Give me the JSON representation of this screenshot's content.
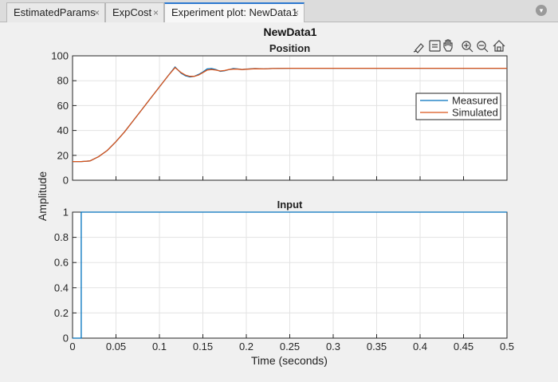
{
  "tabs": [
    {
      "label": "EstimatedParams",
      "close": "×"
    },
    {
      "label": "ExpCost",
      "close": "×"
    },
    {
      "label": "Experiment plot: NewData1",
      "close": "×"
    }
  ],
  "menu_icon": "chevron-down-icon",
  "figure": {
    "title": "NewData1",
    "ylabel": "Amplitude",
    "xlabel": "Time (seconds)",
    "toolbar_icons": [
      "brush-icon",
      "data-tips-icon",
      "pan-hand-icon",
      "zoom-in-icon",
      "zoom-out-icon",
      "home-icon"
    ]
  },
  "chart_data": [
    {
      "type": "line",
      "title": "Position",
      "xlim": [
        0,
        0.5
      ],
      "ylim": [
        0,
        100
      ],
      "xticks": [
        0,
        0.05,
        0.1,
        0.15,
        0.2,
        0.25,
        0.3,
        0.35,
        0.4,
        0.45,
        0.5
      ],
      "yticks": [
        0,
        20,
        40,
        60,
        80,
        100
      ],
      "yticklabels": [
        "0",
        "20",
        "40",
        "60",
        "80",
        "100"
      ],
      "grid": true,
      "legend": "right",
      "series": [
        {
          "name": "Measured",
          "color": "#0072bd",
          "x": [
            0,
            0.01,
            0.02,
            0.03,
            0.04,
            0.05,
            0.06,
            0.07,
            0.08,
            0.09,
            0.1,
            0.11,
            0.118,
            0.125,
            0.13,
            0.135,
            0.14,
            0.145,
            0.15,
            0.155,
            0.16,
            0.165,
            0.17,
            0.175,
            0.18,
            0.185,
            0.19,
            0.195,
            0.2,
            0.21,
            0.22,
            0.23,
            0.25,
            0.3,
            0.35,
            0.4,
            0.45,
            0.5
          ],
          "y": [
            15,
            15,
            15.5,
            19,
            24,
            31,
            39,
            48,
            57,
            66,
            75,
            84,
            91,
            86,
            84,
            83,
            83.5,
            85,
            87,
            89.5,
            89.8,
            89,
            87.5,
            88,
            89,
            89.8,
            89.5,
            89,
            89.3,
            89.8,
            89.5,
            89.8,
            90,
            90,
            90,
            90,
            90,
            90
          ]
        },
        {
          "name": "Simulated",
          "color": "#d95319",
          "x": [
            0,
            0.01,
            0.02,
            0.03,
            0.04,
            0.05,
            0.06,
            0.07,
            0.08,
            0.09,
            0.1,
            0.11,
            0.118,
            0.125,
            0.13,
            0.135,
            0.14,
            0.145,
            0.15,
            0.155,
            0.16,
            0.165,
            0.17,
            0.175,
            0.18,
            0.185,
            0.19,
            0.195,
            0.2,
            0.21,
            0.22,
            0.23,
            0.25,
            0.3,
            0.35,
            0.4,
            0.45,
            0.5
          ],
          "y": [
            15,
            15,
            15.5,
            19,
            24,
            31,
            39,
            48,
            57,
            66,
            75,
            84,
            90.5,
            86.5,
            84.5,
            83.5,
            83.5,
            84.5,
            86.5,
            88.5,
            89,
            88.5,
            87.8,
            88.2,
            89,
            89.3,
            89.3,
            89,
            89.2,
            89.6,
            89.5,
            89.8,
            90,
            90,
            90,
            90,
            90,
            90
          ]
        }
      ]
    },
    {
      "type": "line",
      "title": "Input",
      "xlim": [
        0,
        0.5
      ],
      "ylim": [
        0,
        1
      ],
      "xticks": [
        0,
        0.05,
        0.1,
        0.15,
        0.2,
        0.25,
        0.3,
        0.35,
        0.4,
        0.45,
        0.5
      ],
      "xticklabels": [
        "0",
        "0.05",
        "0.1",
        "0.15",
        "0.2",
        "0.25",
        "0.3",
        "0.35",
        "0.4",
        "0.45",
        "0.5"
      ],
      "yticks": [
        0,
        0.2,
        0.4,
        0.6,
        0.8,
        1
      ],
      "yticklabels": [
        "0",
        "0.2",
        "0.4",
        "0.6",
        "0.8",
        "1"
      ],
      "grid": true,
      "series": [
        {
          "color": "#0072bd",
          "x": [
            0,
            0.01,
            0.01,
            0.5
          ],
          "y": [
            0,
            0,
            1,
            1
          ]
        }
      ]
    }
  ]
}
